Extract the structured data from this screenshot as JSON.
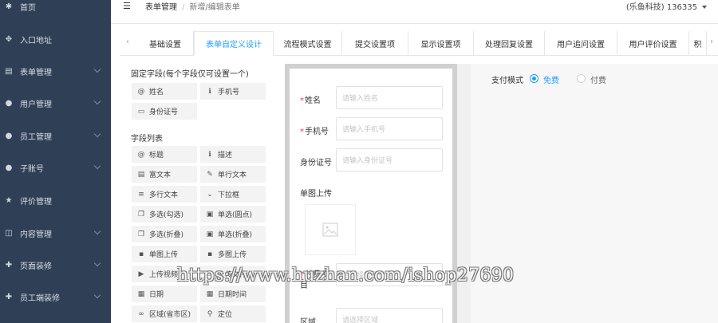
{
  "sidebar": {
    "items": [
      {
        "label": "首页",
        "icon": "gamepad-icon",
        "glyph": "✱",
        "has_chevron": false
      },
      {
        "label": "入口地址",
        "icon": "target-icon",
        "glyph": "✥",
        "has_chevron": false
      },
      {
        "label": "表单管理",
        "icon": "book-icon",
        "glyph": "▤",
        "has_chevron": true
      },
      {
        "label": "用户管理",
        "icon": "user-icon",
        "glyph": "●",
        "has_chevron": true
      },
      {
        "label": "员工管理",
        "icon": "users-icon",
        "glyph": "●",
        "has_chevron": true
      },
      {
        "label": "子账号",
        "icon": "users-icon",
        "glyph": "●",
        "has_chevron": true
      },
      {
        "label": "评价管理",
        "icon": "star-icon",
        "glyph": "★",
        "has_chevron": false
      },
      {
        "label": "内容管理",
        "icon": "open-book-icon",
        "glyph": "◫",
        "has_chevron": true
      },
      {
        "label": "页面装修",
        "icon": "move-icon",
        "glyph": "✚",
        "has_chevron": true
      },
      {
        "label": "员工端装修",
        "icon": "move-icon",
        "glyph": "✚",
        "has_chevron": true
      }
    ]
  },
  "header": {
    "menu_glyph": "☰",
    "breadcrumb_1": "表单管理",
    "breadcrumb_sep": "/",
    "breadcrumb_2": "新增/编辑表单",
    "user": "(乐鱼科技) 136335"
  },
  "tabs": {
    "prev": "‹",
    "next": "›",
    "items": [
      "基础设置",
      "表单自定义设计",
      "流程模式设置",
      "提交设置项",
      "显示设置项",
      "处理回复设置",
      "用户追问设置",
      "用户评价设置",
      "积"
    ],
    "active_index": 1
  },
  "fixed_fields": {
    "title": "固定字段(每个字段仅可设置一个)",
    "items": [
      {
        "label": "姓名",
        "icon": "at-icon",
        "glyph": "@"
      },
      {
        "label": "手机号",
        "icon": "info-icon",
        "glyph": "ℹ"
      },
      {
        "label": "身份证号",
        "icon": "id-card-icon",
        "glyph": "▭"
      }
    ]
  },
  "field_list": {
    "title": "字段列表",
    "items": [
      {
        "label": "标题",
        "icon": "at-icon",
        "glyph": "@"
      },
      {
        "label": "描述",
        "icon": "info-icon",
        "glyph": "ℹ"
      },
      {
        "label": "富文本",
        "icon": "doc-icon",
        "glyph": "▤"
      },
      {
        "label": "单行文本",
        "icon": "edit-icon",
        "glyph": "✎"
      },
      {
        "label": "多行文本",
        "icon": "list-icon",
        "glyph": "≡"
      },
      {
        "label": "下拉框",
        "icon": "chevron-down-icon",
        "glyph": "⌄"
      },
      {
        "label": "多选(勾选)",
        "icon": "copy-icon",
        "glyph": "❐"
      },
      {
        "label": "单选(圆点)",
        "icon": "window-icon",
        "glyph": "▣"
      },
      {
        "label": "多选(折叠)",
        "icon": "copy-icon",
        "glyph": "❐"
      },
      {
        "label": "单选(折叠)",
        "icon": "window-icon",
        "glyph": "▣"
      },
      {
        "label": "单图上传",
        "icon": "image-icon",
        "glyph": "▪"
      },
      {
        "label": "多图上传",
        "icon": "images-icon",
        "glyph": "▪"
      },
      {
        "label": "上传视频",
        "icon": "video-icon",
        "glyph": "▶"
      },
      {
        "label": "上传文件",
        "icon": "file-icon",
        "glyph": "▭"
      },
      {
        "label": "日期",
        "icon": "calendar-icon",
        "glyph": "▦"
      },
      {
        "label": "日期时间",
        "icon": "calendar-icon",
        "glyph": "▦"
      },
      {
        "label": "区域(省市区)",
        "icon": "link-icon",
        "glyph": "∞"
      },
      {
        "label": "定位",
        "icon": "map-pin-icon",
        "glyph": "⚲"
      }
    ]
  },
  "preview": {
    "fields": [
      {
        "label": "姓名",
        "required": true,
        "placeholder": "请输入姓名"
      },
      {
        "label": "手机号",
        "required": true,
        "placeholder": "请输入手机号"
      },
      {
        "label": "身份证号",
        "required": false,
        "placeholder": "请输入身份证号"
      }
    ],
    "upload_label": "单图上传",
    "paid_label_1": "付费项",
    "paid_label_2": "目",
    "paid_placeholder": "请选择需要付费",
    "region_label": "区域",
    "region_placeholder": "请选择区域"
  },
  "pay_mode": {
    "label": "支付模式",
    "options": [
      "免费",
      "付费"
    ],
    "selected": "免费"
  },
  "watermark": "https://www.huzhan.com/ishop27690",
  "colors": {
    "sidebar_bg": "#2f4056",
    "accent": "#1e9fff",
    "required": "#e33333"
  }
}
